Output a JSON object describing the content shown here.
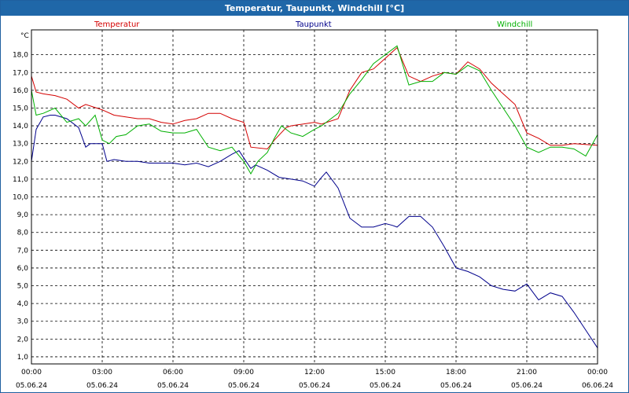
{
  "window": {
    "title": "Temperatur, Taupunkt, Windchill [°C]"
  },
  "colors": {
    "temperatur": "#d40000",
    "taupunkt": "#00008b",
    "windchill": "#00b000",
    "grid": "#000000"
  },
  "chart_data": {
    "type": "line",
    "title": "Temperatur, Taupunkt, Windchill [°C]",
    "ylabel": "°C",
    "xlabel": "",
    "ylim": [
      0.6,
      19.4
    ],
    "yticks": [
      1.0,
      2.0,
      3.0,
      4.0,
      5.0,
      6.0,
      7.0,
      8.0,
      9.0,
      10.0,
      11.0,
      12.0,
      13.0,
      14.0,
      15.0,
      16.0,
      17.0,
      18.0
    ],
    "ytick_labels": [
      "1,0",
      "2,0",
      "3,0",
      "4,0",
      "5,0",
      "6,0",
      "7,0",
      "8,0",
      "9,0",
      "10,0",
      "11,0",
      "12,0",
      "13,0",
      "14,0",
      "15,0",
      "16,0",
      "17,0",
      "18,0"
    ],
    "xlim": [
      0,
      24
    ],
    "xticks": [
      {
        "time": "00:00",
        "date": "05.06.24"
      },
      {
        "time": "03:00",
        "date": "05.06.24"
      },
      {
        "time": "06:00",
        "date": "05.06.24"
      },
      {
        "time": "09:00",
        "date": "05.06.24"
      },
      {
        "time": "12:00",
        "date": "05.06.24"
      },
      {
        "time": "15:00",
        "date": "05.06.24"
      },
      {
        "time": "18:00",
        "date": "05.06.24"
      },
      {
        "time": "21:00",
        "date": "05.06.24"
      },
      {
        "time": "00:00",
        "date": "06.06.24"
      }
    ],
    "grid": true,
    "legend_position": "top",
    "series": [
      {
        "name": "Temperatur",
        "x": [
          0,
          0.2,
          0.5,
          1,
          1.5,
          2,
          2.3,
          3,
          3.5,
          4,
          4.5,
          5,
          5.5,
          6,
          6.5,
          7,
          7.5,
          8,
          8.5,
          9,
          9.3,
          10,
          10.3,
          10.8,
          11,
          12,
          12.3,
          13,
          13.5,
          14,
          14.5,
          15,
          15.5,
          16,
          16.5,
          17,
          17.5,
          18,
          18.5,
          19,
          19.5,
          20,
          20.5,
          21,
          21.5,
          22,
          22.5,
          23,
          24
        ],
        "y": [
          16.8,
          15.9,
          15.8,
          15.7,
          15.5,
          15.0,
          15.2,
          14.9,
          14.6,
          14.5,
          14.4,
          14.4,
          14.2,
          14.1,
          14.3,
          14.4,
          14.7,
          14.7,
          14.4,
          14.2,
          12.8,
          12.7,
          13.2,
          13.9,
          14.0,
          14.2,
          14.1,
          14.4,
          16.0,
          17.0,
          17.2,
          17.8,
          18.4,
          16.8,
          16.5,
          16.8,
          17.0,
          16.9,
          17.6,
          17.2,
          16.4,
          15.8,
          15.2,
          13.6,
          13.3,
          12.9,
          12.9,
          13.0,
          12.9
        ]
      },
      {
        "name": "Taupunkt",
        "x": [
          0,
          0.2,
          0.5,
          0.8,
          1,
          1.5,
          2,
          2.3,
          2.5,
          3,
          3.2,
          3.5,
          4,
          4.5,
          5,
          5.5,
          6,
          6.5,
          7,
          7.5,
          8,
          8.5,
          8.8,
          9,
          9.3,
          9.5,
          10,
          10.5,
          11,
          11.5,
          12,
          12.3,
          12.5,
          13,
          13.5,
          14,
          14.5,
          15,
          15.3,
          15.5,
          16,
          16.5,
          17,
          17.5,
          18,
          18.5,
          19,
          19.5,
          20,
          20.5,
          21,
          21.5,
          22,
          22.5,
          23,
          23.5,
          24
        ],
        "y": [
          12.0,
          13.8,
          14.5,
          14.6,
          14.6,
          14.4,
          13.9,
          12.8,
          13.0,
          13.0,
          12.0,
          12.1,
          12.0,
          12.0,
          11.9,
          11.9,
          11.9,
          11.8,
          11.9,
          11.7,
          12.0,
          12.4,
          12.6,
          12.2,
          11.6,
          11.8,
          11.5,
          11.1,
          11.0,
          10.9,
          10.6,
          11.1,
          11.4,
          10.5,
          8.8,
          8.3,
          8.3,
          8.5,
          8.4,
          8.3,
          8.9,
          8.9,
          8.3,
          7.2,
          6.0,
          5.8,
          5.5,
          5.0,
          4.8,
          4.7,
          5.1,
          4.2,
          4.6,
          4.4,
          3.5,
          2.5,
          1.5
        ]
      },
      {
        "name": "Windchill",
        "x": [
          0,
          0.2,
          0.5,
          1,
          1.5,
          2,
          2.3,
          2.7,
          3,
          3.3,
          3.6,
          4,
          4.5,
          5,
          5.5,
          6,
          6.5,
          7,
          7.5,
          8,
          8.5,
          9,
          9.3,
          9.6,
          10,
          10.3,
          10.6,
          11,
          11.5,
          12,
          12.3,
          13,
          13.5,
          14,
          14.5,
          15,
          15.5,
          16,
          16.5,
          17,
          17.5,
          18,
          18.5,
          19,
          19.5,
          20,
          20.5,
          21,
          21.5,
          22,
          22.5,
          23,
          23.5,
          24
        ],
        "y": [
          16.0,
          14.6,
          14.7,
          15.0,
          14.2,
          14.4,
          14.0,
          14.6,
          13.2,
          13.0,
          13.4,
          13.5,
          14.0,
          14.1,
          13.7,
          13.6,
          13.6,
          13.8,
          12.8,
          12.6,
          12.8,
          12.0,
          11.3,
          12.0,
          12.5,
          13.3,
          14.0,
          13.6,
          13.4,
          13.8,
          14.0,
          14.7,
          15.8,
          16.6,
          17.5,
          18.0,
          18.5,
          16.3,
          16.5,
          16.5,
          17.0,
          16.9,
          17.4,
          17.1,
          16.0,
          15.0,
          14.0,
          12.8,
          12.5,
          12.8,
          12.8,
          12.7,
          12.3,
          13.5
        ]
      }
    ]
  }
}
